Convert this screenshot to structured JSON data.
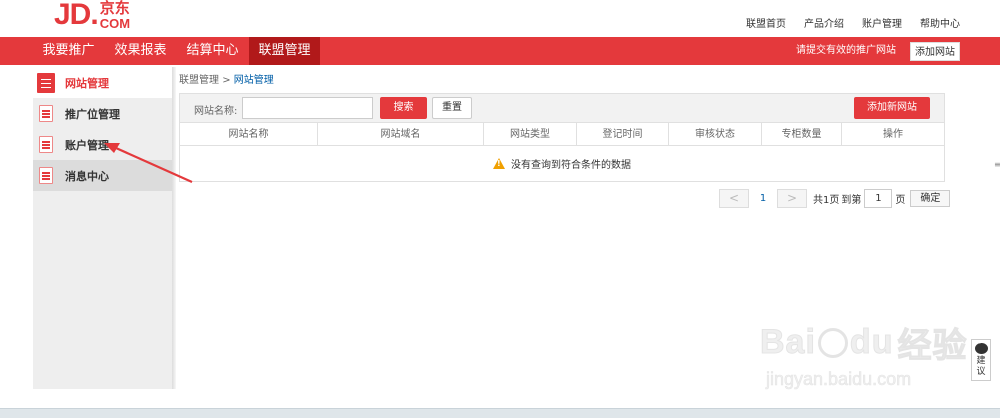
{
  "header": {
    "logo_jd": "JD.",
    "logo_cn": "京东",
    "logo_com": "COM",
    "links": [
      "联盟首页",
      "产品介绍",
      "账户管理",
      "帮助中心"
    ]
  },
  "nav": {
    "items": [
      "我要推广",
      "效果报表",
      "结算中心",
      "联盟管理"
    ],
    "active_index": 3,
    "hint": "请提交有效的推广网站",
    "add_site": "添加网站"
  },
  "sidebar": {
    "items": [
      {
        "label": "网站管理",
        "active": true
      },
      {
        "label": "推广位管理",
        "active": false
      },
      {
        "label": "账户管理",
        "active": false
      },
      {
        "label": "消息中心",
        "active": false
      }
    ]
  },
  "breadcrumb": {
    "parent": "联盟管理",
    "separator": ">",
    "current": "网站管理"
  },
  "search": {
    "label": "网站名称:",
    "value": "",
    "search_btn": "搜索",
    "reset_btn": "重置",
    "add_btn": "添加新网站"
  },
  "table": {
    "headers": [
      "网站名称",
      "网站域名",
      "网站类型",
      "登记时间",
      "审核状态",
      "专柜数量",
      "操作"
    ],
    "empty_text": "没有查询到符合条件的数据"
  },
  "pager": {
    "prev": "<",
    "page": "1",
    "next": ">",
    "total": "共1页",
    "goto": "到第",
    "input": "1",
    "page_unit": "页",
    "ok": "确定"
  },
  "feedback": {
    "label": "建议"
  },
  "watermark": {
    "main_left": "Bai",
    "main_right": "du",
    "main_cn": "经验",
    "sub": "jingyan.baidu.com"
  },
  "colors": {
    "brand_red": "#e4393c",
    "nav_active": "#b1191a",
    "link_blue": "#005ea7"
  }
}
